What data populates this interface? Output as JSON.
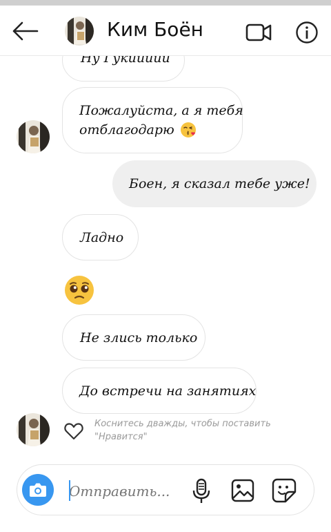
{
  "header": {
    "contact_name": "Ким Боён",
    "back_icon": "arrow-left-icon",
    "video_icon": "video-call-icon",
    "info_icon": "info-icon"
  },
  "messages": [
    {
      "direction": "incoming",
      "text": "Ну Гукиииии"
    },
    {
      "direction": "incoming",
      "text_line1": "Пожалуйста, а я тебя",
      "text_line2": "отблагодарю",
      "emoji": "kissing-face"
    },
    {
      "direction": "outgoing",
      "text": "Боен, я сказал тебе уже!"
    },
    {
      "direction": "incoming",
      "text": "Ладно"
    },
    {
      "direction": "incoming",
      "emoji": "pleading-face"
    },
    {
      "direction": "incoming",
      "text": "Не злись только"
    },
    {
      "direction": "incoming",
      "text": "До встречи на занятиях"
    }
  ],
  "like_hint": {
    "line1": "Коснитесь дважды, чтобы поставить",
    "line2": "\"Нравится\""
  },
  "composer": {
    "placeholder": "Отправить...",
    "camera_icon": "camera-icon",
    "mic_icon": "microphone-icon",
    "gallery_icon": "gallery-icon",
    "sticker_icon": "sticker-icon"
  },
  "colors": {
    "accent": "#3897f0",
    "outgoing_bubble": "#efefef",
    "bubble_border": "#e3e3e3"
  }
}
